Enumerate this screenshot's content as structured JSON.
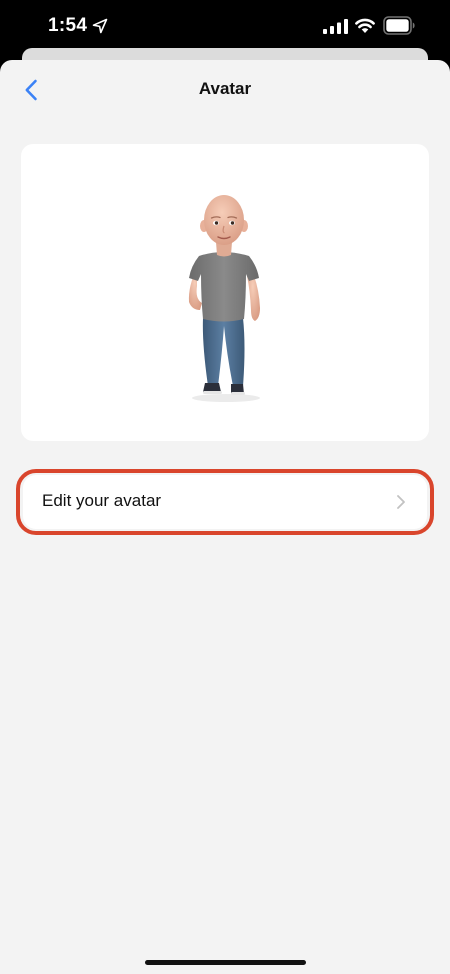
{
  "status_bar": {
    "time": "1:54"
  },
  "nav": {
    "title": "Avatar",
    "back_icon": "chevron-left-icon"
  },
  "avatar_card": {
    "image": "3d-avatar-figure"
  },
  "menu": {
    "edit_label": "Edit your avatar",
    "chevron_icon": "chevron-right-icon"
  },
  "colors": {
    "accent_blue": "#3b82f6",
    "highlight_red": "#d9452c",
    "background": "#f3f3f3"
  }
}
